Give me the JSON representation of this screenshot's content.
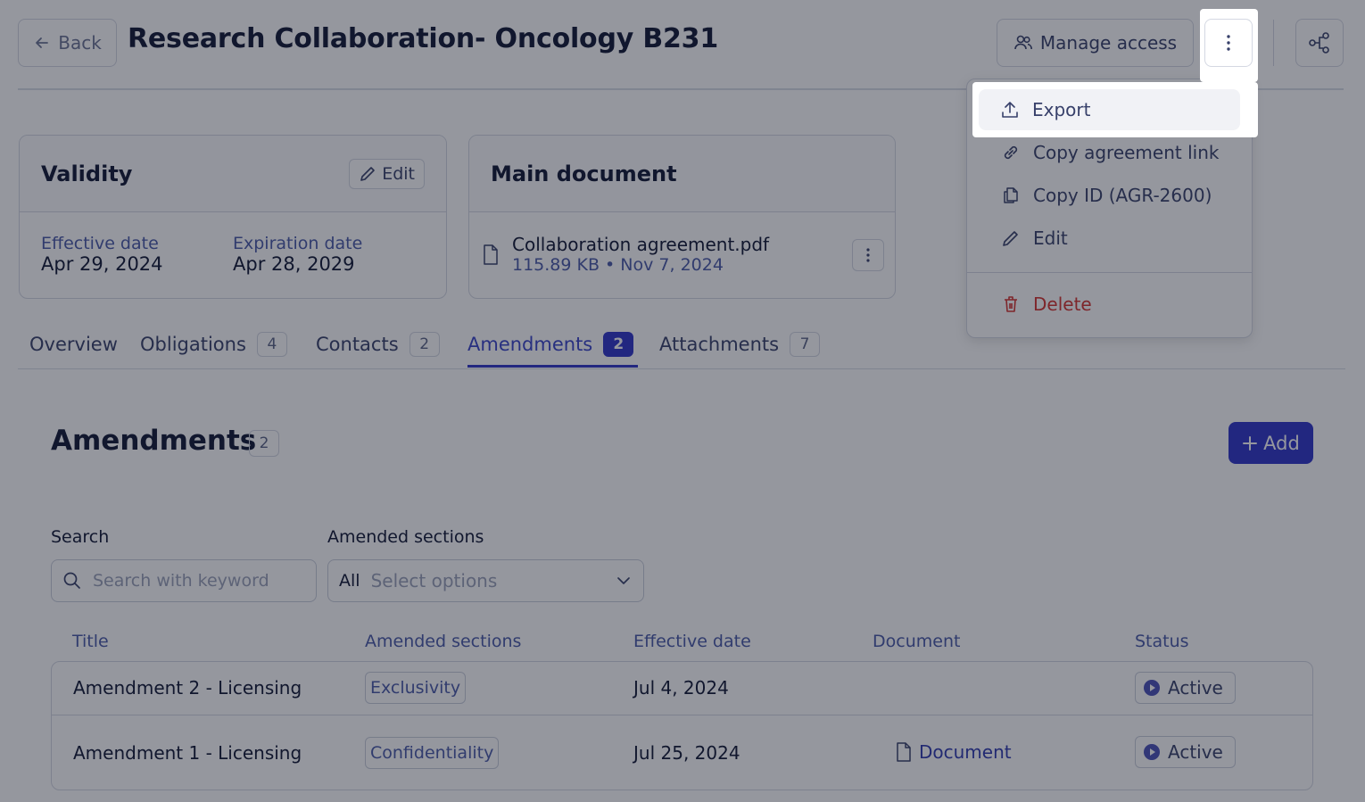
{
  "header": {
    "back_label": "Back",
    "title": "Research Collaboration- Oncology B231",
    "manage_access_label": "Manage access"
  },
  "validity": {
    "title": "Validity",
    "edit_label": "Edit",
    "effective_label": "Effective date",
    "effective_value": "Apr 29, 2024",
    "expiration_label": "Expiration date",
    "expiration_value": "Apr 28, 2029"
  },
  "main_document": {
    "title": "Main document",
    "file_name": "Collaboration agreement.pdf",
    "file_meta": "115.89 KB • Nov 7, 2024"
  },
  "tabs": [
    {
      "label": "Overview",
      "count": ""
    },
    {
      "label": "Obligations",
      "count": "4"
    },
    {
      "label": "Contacts",
      "count": "2"
    },
    {
      "label": "Amendments",
      "count": "2"
    },
    {
      "label": "Attachments",
      "count": "7"
    }
  ],
  "amendments": {
    "title": "Amendments",
    "count": "2",
    "add_label": "Add",
    "search_label": "Search",
    "search_placeholder": "Search with keyword",
    "sections_label": "Amended sections",
    "select_all": "All",
    "select_placeholder": "Select options",
    "columns": [
      "Title",
      "Amended sections",
      "Effective date",
      "Document",
      "Status"
    ],
    "rows": [
      {
        "title": "Amendment 2 - Licensing",
        "section": "Exclusivity",
        "date": "Jul 4, 2024",
        "document": "",
        "status": "Active"
      },
      {
        "title": "Amendment 1 - Licensing",
        "section": "Confidentiality",
        "date": "Jul 25, 2024",
        "document": "Document",
        "status": "Active"
      }
    ]
  },
  "menu": {
    "items": [
      {
        "label": "Export",
        "icon": "upload-icon"
      },
      {
        "label": "Copy agreement link",
        "icon": "link-icon"
      },
      {
        "label": "Copy ID (AGR-2600)",
        "icon": "copy-icon"
      },
      {
        "label": "Edit",
        "icon": "pencil-icon"
      },
      {
        "label": "Delete",
        "icon": "trash-icon"
      }
    ]
  },
  "colors": {
    "accent": "#2e34c9",
    "danger": "#d6322f",
    "text": "#0f1633",
    "overlay": "rgba(20,24,40,0.45)"
  }
}
